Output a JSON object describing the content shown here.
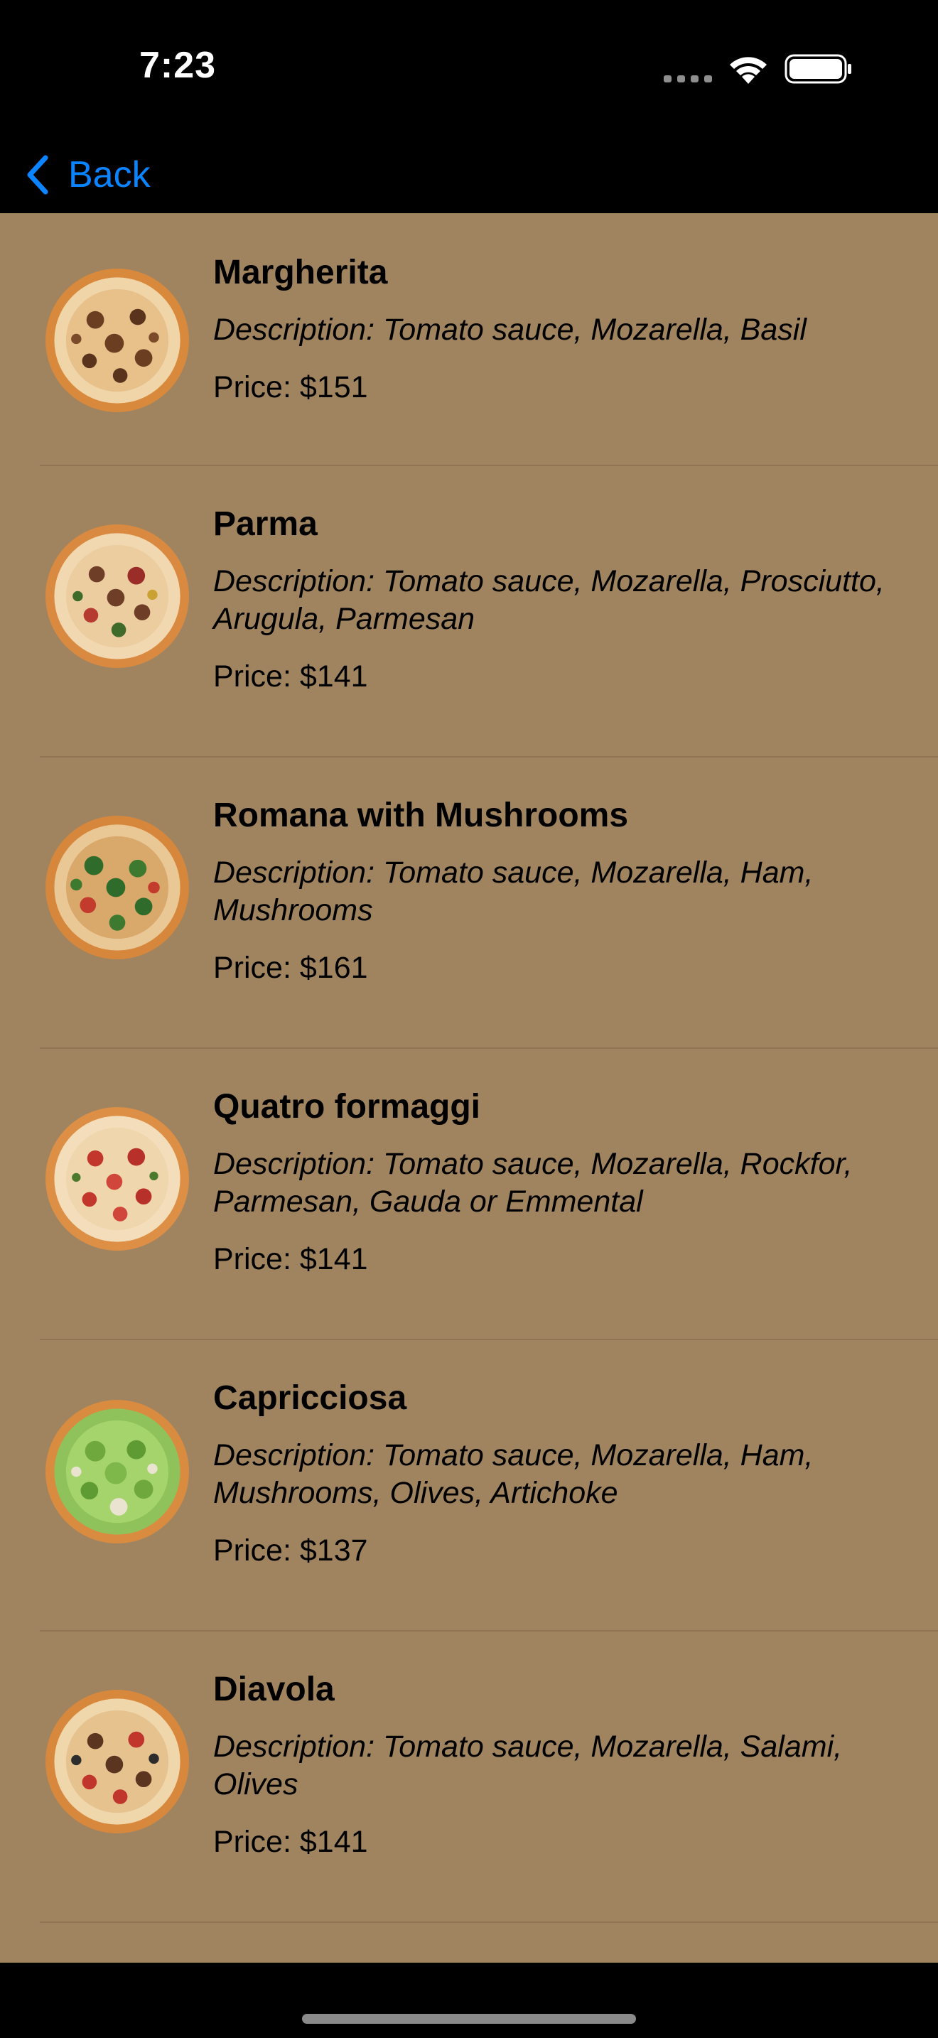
{
  "status_bar": {
    "time": "7:23",
    "icons": [
      "cellular-signal-icon",
      "wifi-icon",
      "battery-icon"
    ]
  },
  "nav": {
    "back_label": "Back",
    "accent_color": "#0a84ff"
  },
  "theme": {
    "list_background": "#a08460",
    "separator": "#8f7553"
  },
  "pizzas": [
    {
      "name": "Margherita",
      "description": "Description: Tomato sauce, Mozarella, Basil",
      "price": "Price: $151",
      "image": "pizza-photo"
    },
    {
      "name": "Parma",
      "description": "Description: Tomato sauce, Mozarella, Prosciutto, Arugula, Parmesan",
      "price": "Price: $141",
      "image": "pizza-photo"
    },
    {
      "name": "Romana with Mushrooms",
      "description": "Description: Tomato sauce, Mozarella, Ham, Mushrooms",
      "price": "Price: $161",
      "image": "pizza-photo"
    },
    {
      "name": "Quatro formaggi",
      "description": "Description: Tomato sauce, Mozarella, Rockfor, Parmesan, Gauda or Emmental",
      "price": "Price: $141",
      "image": "pizza-photo"
    },
    {
      "name": "Capricciosa",
      "description": "Description: Tomato sauce, Mozarella, Ham, Mushrooms, Olives, Artichoke",
      "price": "Price: $137",
      "image": "pizza-photo"
    },
    {
      "name": "Diavola",
      "description": "Description: Tomato sauce, Mozarella, Salami, Olives",
      "price": "Price: $141",
      "image": "pizza-photo"
    }
  ]
}
